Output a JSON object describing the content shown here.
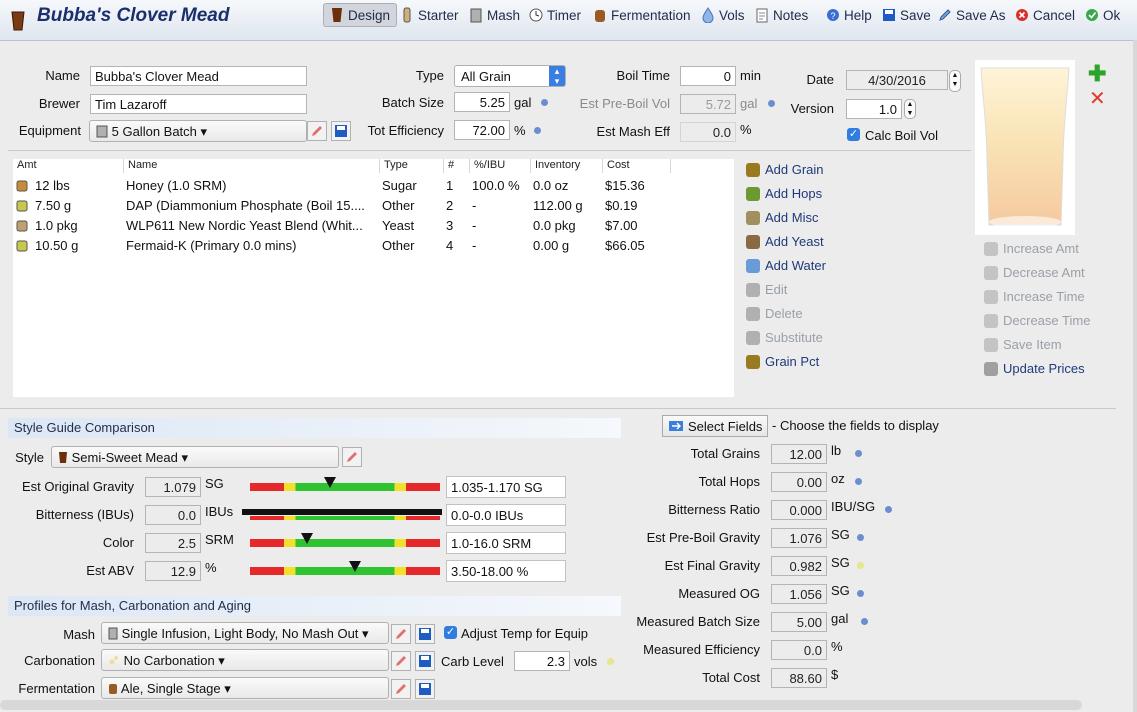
{
  "title": "Bubba's Clover Mead",
  "toolbar": {
    "design": "Design",
    "starter": "Starter",
    "mash": "Mash",
    "timer": "Timer",
    "fermentation": "Fermentation",
    "vols": "Vols",
    "notes": "Notes",
    "help": "Help",
    "save": "Save",
    "save_as": "Save As",
    "cancel": "Cancel",
    "ok": "Ok"
  },
  "form": {
    "name_label": "Name",
    "name": "Bubba's Clover Mead",
    "brewer_label": "Brewer",
    "brewer": "Tim Lazaroff",
    "equipment_label": "Equipment",
    "equipment": "5 Gallon Batch",
    "type_label": "Type",
    "type": "All Grain",
    "batch_size_label": "Batch Size",
    "batch_size": "5.25",
    "batch_unit": "gal",
    "tot_eff_label": "Tot Efficiency",
    "tot_eff": "72.00",
    "tot_eff_unit": "%",
    "boil_time_label": "Boil Time",
    "boil_time": "0",
    "boil_unit": "min",
    "pre_boil_label": "Est Pre-Boil Vol",
    "pre_boil": "5.72",
    "pre_boil_unit": "gal",
    "mash_eff_label": "Est Mash Eff",
    "mash_eff": "0.0",
    "mash_eff_unit": "%",
    "date_label": "Date",
    "date": "4/30/2016",
    "version_label": "Version",
    "version": "1.0",
    "calc_boil": "Calc Boil Vol"
  },
  "table": {
    "headers": [
      "Amt",
      "Name",
      "Type",
      "#",
      "%/IBU",
      "Inventory",
      "Cost"
    ],
    "rows": [
      [
        "12 lbs",
        "Honey (1.0 SRM)",
        "Sugar",
        "1",
        "100.0 %",
        "0.0 oz",
        "$15.36"
      ],
      [
        "7.50 g",
        "DAP (Diammonium Phosphate (Boil 15....",
        "Other",
        "2",
        "-",
        "112.00 g",
        "$0.19"
      ],
      [
        "1.0 pkg",
        "WLP611 New Nordic Yeast Blend (Whit...",
        "Yeast",
        "3",
        "-",
        "0.0 pkg",
        "$7.00"
      ],
      [
        "10.50 g",
        "Fermaid-K (Primary 0.0 mins)",
        "Other",
        "4",
        "-",
        "0.00 g",
        "$66.05"
      ]
    ]
  },
  "actions": [
    "Add Grain",
    "Add Hops",
    "Add Misc",
    "Add Yeast",
    "Add Water",
    "Edit",
    "Delete",
    "Substitute",
    "Grain Pct"
  ],
  "side_actions": [
    "Increase Amt",
    "Decrease Amt",
    "Increase Time",
    "Decrease Time",
    "Save Item",
    "Update Prices"
  ],
  "style": {
    "header": "Style Guide Comparison",
    "style_label": "Style",
    "style": "Semi-Sweet Mead",
    "rows": [
      {
        "label": "Est Original Gravity",
        "value": "1.079",
        "unit": "SG",
        "range": "1.035-1.170 SG",
        "marker": 0.42
      },
      {
        "label": "Bitterness (IBUs)",
        "value": "0.0",
        "unit": "IBUs",
        "range": "0.0-0.0 IBUs",
        "marker": null
      },
      {
        "label": "Color",
        "value": "2.5",
        "unit": "SRM",
        "range": "1.0-16.0 SRM",
        "marker": 0.3
      },
      {
        "label": "Est ABV",
        "value": "12.9",
        "unit": "%",
        "range": "3.50-18.00 %",
        "marker": 0.55
      }
    ]
  },
  "profiles": {
    "header": "Profiles for Mash, Carbonation and Aging",
    "mash_label": "Mash",
    "mash": "Single Infusion, Light Body, No Mash Out",
    "adjust_temp": "Adjust Temp for Equip",
    "carb_label": "Carbonation",
    "carb": "No Carbonation",
    "carb_level_label": "Carb Level",
    "carb_level": "2.3",
    "carb_unit": "vols",
    "ferm_label": "Fermentation",
    "ferm": "Ale, Single Stage"
  },
  "fields": {
    "select_button": "Select Fields",
    "hint": "- Choose the fields to display",
    "rows": [
      {
        "label": "Total Grains",
        "value": "12.00",
        "unit": "lb",
        "dot": "blue"
      },
      {
        "label": "Total Hops",
        "value": "0.00",
        "unit": "oz",
        "dot": "blue"
      },
      {
        "label": "Bitterness Ratio",
        "value": "0.000",
        "unit": "IBU/SG",
        "dot": "blue"
      },
      {
        "label": "Est Pre-Boil Gravity",
        "value": "1.076",
        "unit": "SG",
        "dot": "blue"
      },
      {
        "label": "Est Final Gravity",
        "value": "0.982",
        "unit": "SG",
        "dot": "yellow"
      },
      {
        "label": "Measured OG",
        "value": "1.056",
        "unit": "SG",
        "dot": "blue"
      },
      {
        "label": "Measured Batch Size",
        "value": "5.00",
        "unit": "gal",
        "dot": "blue"
      },
      {
        "label": "Measured Efficiency",
        "value": "0.0",
        "unit": "%",
        "dot": "none"
      },
      {
        "label": "Total Cost",
        "value": "88.60",
        "unit": "$",
        "dot": "none"
      }
    ]
  }
}
